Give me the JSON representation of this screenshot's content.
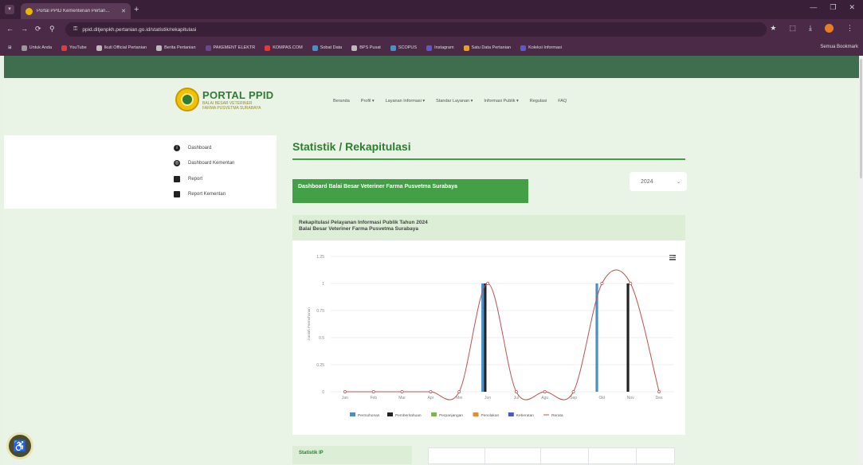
{
  "browser": {
    "tab_title": "Portal PPID Kementerian Pertan...",
    "url": "ppid.ditjenpkh.pertanian.go.id/statistik/rekapitulasi",
    "bookmarks": [
      "Untuk Anda",
      "YouTube",
      "Ikuti Official Pertanian",
      "Berita Pertanian",
      "PAKEMENT ELEKTR",
      "KOMPAS.COM",
      "Sobat Data",
      "BPS Pusat",
      "SCOPUS",
      "Instagram",
      "Satu Data Pertanian",
      "Koleksi Informasi"
    ],
    "bookmarks_right": "Semua Bookmark"
  },
  "brand": {
    "title": "PORTAL PPID",
    "subtitle_1": "BALAI BESAR VETERINER",
    "subtitle_2": "FARMA PUSVETMA SURABAYA"
  },
  "nav": [
    "Beranda",
    "Profil ▾",
    "Layanan Informasi ▾",
    "Standar Layanan ▾",
    "Informasi Publik ▾",
    "Regulasi",
    "FAQ"
  ],
  "sidebar": [
    {
      "label": "Dashboard",
      "icon": "info-icon"
    },
    {
      "label": "Dashboard Kementan",
      "icon": "globe-icon"
    },
    {
      "label": "Report",
      "icon": "book-icon"
    },
    {
      "label": "Report Kementan",
      "icon": "book-icon"
    }
  ],
  "page_title": "Statistik / Rekapitulasi",
  "dashboard_button": "Dashboard Balai Besar Veteriner Farma Pusvetma Surabaya",
  "year_select": "2024",
  "chart_heading": {
    "line1": "Rekapitulasi Pelayanan Informasi Publik Tahun 2024",
    "line2": "Balai Besar Veteriner Farma Pusvetma Surabaya"
  },
  "stat_card": "Statistik IP",
  "accessibility_label": "♿",
  "chart_data": {
    "type": "bar",
    "categories": [
      "Jan",
      "Feb",
      "Mar",
      "Apr",
      "Mei",
      "Jun",
      "Jul",
      "Agu",
      "Sep",
      "Okt",
      "Nov",
      "Des"
    ],
    "ylim": [
      0,
      1.25
    ],
    "yticks": [
      "0",
      "0.25",
      "0.5",
      "0.75",
      "1",
      "1.25"
    ],
    "ylabel": "Jumlah Permohonan",
    "colors": {
      "Permohonan": "#4a90c8",
      "Pemberitahuan": "#222222",
      "Perpanjangan": "#7ab648",
      "Penolakan": "#e8883a",
      "Keberatan": "#4a5ab8",
      "Rerata": "#c0504d"
    },
    "series": [
      {
        "name": "Permohonan",
        "values": [
          0,
          0,
          0,
          0,
          0,
          1,
          0,
          0,
          0,
          1,
          0,
          0
        ]
      },
      {
        "name": "Pemberitahuan",
        "values": [
          0,
          0,
          0,
          0,
          0,
          1,
          0,
          0,
          0,
          0,
          1,
          0
        ]
      },
      {
        "name": "Perpanjangan",
        "values": [
          0,
          0,
          0,
          0,
          0,
          0,
          0,
          0,
          0,
          0,
          0,
          0
        ]
      },
      {
        "name": "Penolakan",
        "values": [
          0,
          0,
          0,
          0,
          0,
          0,
          0,
          0,
          0,
          0,
          0,
          0
        ]
      },
      {
        "name": "Keberatan",
        "values": [
          0,
          0,
          0,
          0,
          0,
          0,
          0,
          0,
          0,
          0,
          0,
          0
        ]
      },
      {
        "name": "Rerata",
        "values": [
          0,
          0,
          0,
          0,
          0,
          1,
          0,
          0,
          0,
          1,
          1,
          0
        ],
        "kind": "line"
      }
    ]
  }
}
